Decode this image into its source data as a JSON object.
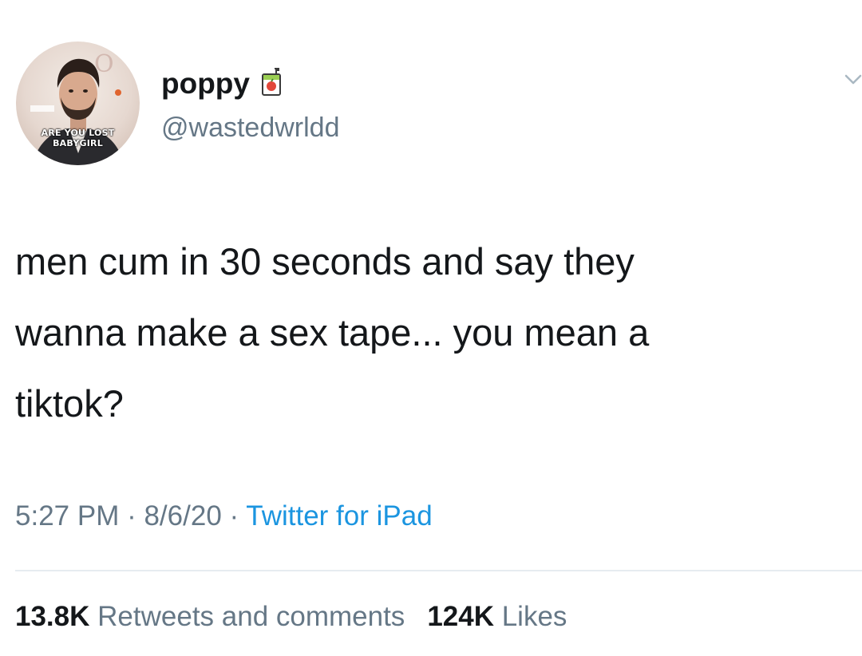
{
  "user": {
    "display_name": "poppy",
    "handle": "@wastedwrldd",
    "name_icon": "juice-box-icon",
    "avatar_caption_line1": "ARE YOU LOST",
    "avatar_caption_line2": "BABYGIRL"
  },
  "tweet": {
    "text_lines": [
      "men cum in 30 seconds and say they",
      "wanna make a sex tape... you mean a",
      "tiktok?"
    ]
  },
  "meta": {
    "time": "5:27 PM",
    "separator": " · ",
    "date": "8/6/20",
    "source": "Twitter for iPad"
  },
  "stats": {
    "retweets_count": "13.8K",
    "retweets_label": "Retweets and comments",
    "likes_count": "124K",
    "likes_label": "Likes"
  },
  "icons": {
    "menu": "chevron-down-icon"
  },
  "colors": {
    "text": "#14171a",
    "secondary": "#657786",
    "link": "#1b95e0",
    "divider": "#e6ecf0"
  }
}
